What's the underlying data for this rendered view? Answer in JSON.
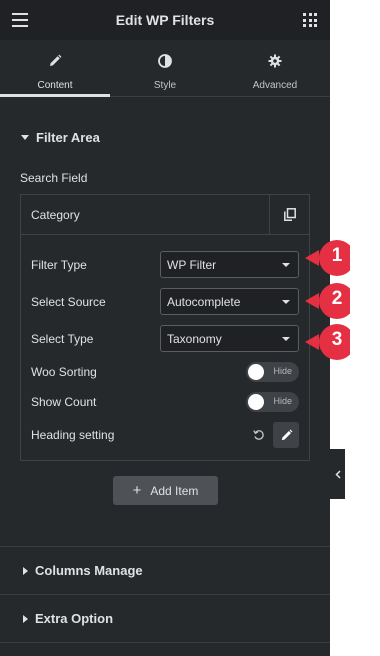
{
  "header": {
    "title": "Edit WP Filters"
  },
  "tabs": [
    {
      "label": "Content",
      "icon": "pencil-icon",
      "active": true
    },
    {
      "label": "Style",
      "icon": "half-circle-icon",
      "active": false
    },
    {
      "label": "Advanced",
      "icon": "gear-icon",
      "active": false
    }
  ],
  "filter_area": {
    "title": "Filter Area",
    "search_field_label": "Search Field",
    "item": {
      "title": "Category",
      "filter_type": {
        "label": "Filter Type",
        "value": "WP Filter"
      },
      "select_source": {
        "label": "Select Source",
        "value": "Autocomplete"
      },
      "select_type": {
        "label": "Select Type",
        "value": "Taxonomy"
      },
      "woo_sorting": {
        "label": "Woo Sorting",
        "toggle": "Hide"
      },
      "show_count": {
        "label": "Show Count",
        "toggle": "Hide"
      },
      "heading_setting": {
        "label": "Heading setting"
      }
    },
    "add_item_label": "Add Item"
  },
  "sections": [
    {
      "title": "Columns Manage"
    },
    {
      "title": "Extra Option"
    }
  ],
  "callouts": [
    "1",
    "2",
    "3"
  ],
  "colors": {
    "panel_bg": "#26292c",
    "header_bg": "#1f2124",
    "text": "#e0e1e3",
    "callout_red": "#e53043"
  }
}
